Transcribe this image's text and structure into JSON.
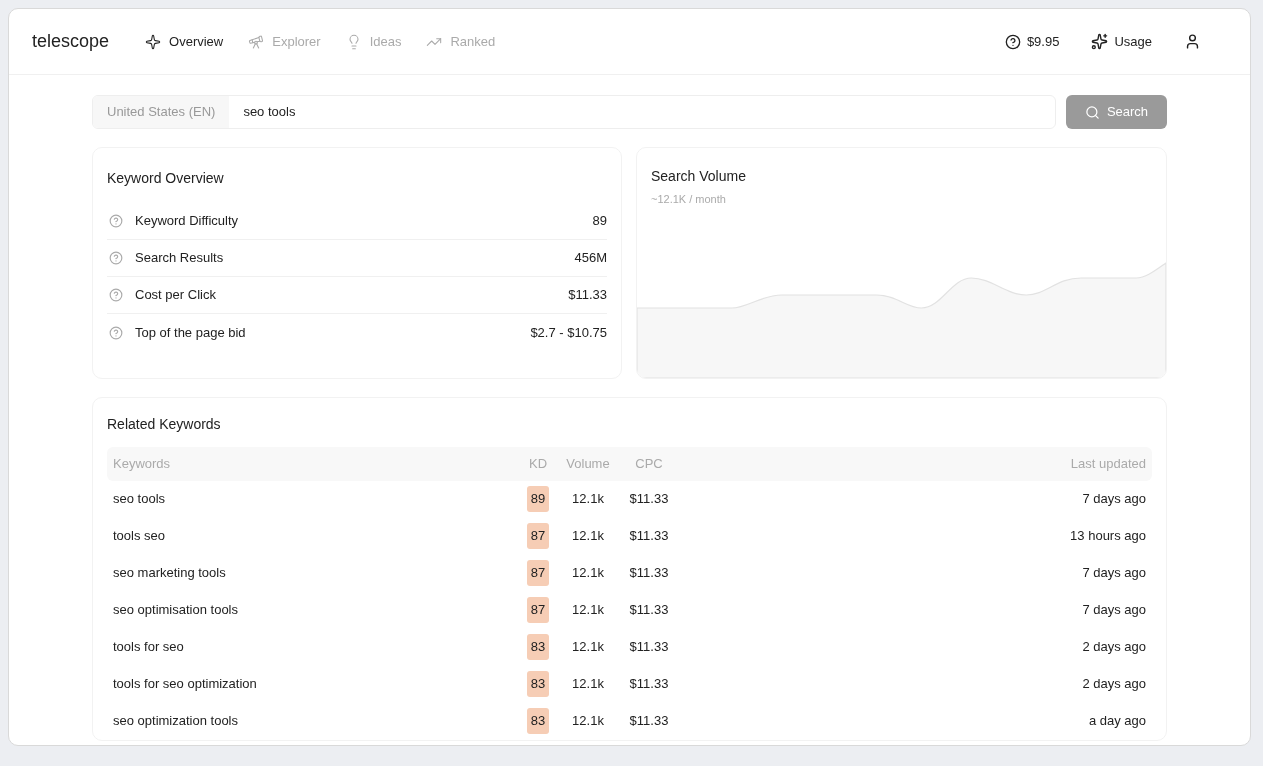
{
  "brand": "telescope",
  "nav": [
    {
      "label": "Overview",
      "selected": true
    },
    {
      "label": "Explorer",
      "selected": false
    },
    {
      "label": "Ideas",
      "selected": false
    },
    {
      "label": "Ranked",
      "selected": false
    }
  ],
  "header_right": {
    "credits": "$9.95",
    "usage": "Usage"
  },
  "search": {
    "region": "United States (EN)",
    "value": "seo tools",
    "button": "Search"
  },
  "overview": {
    "title": "Keyword Overview",
    "metrics": [
      {
        "label": "Keyword Difficulty",
        "value": "89"
      },
      {
        "label": "Search Results",
        "value": "456M"
      },
      {
        "label": "Cost per Click",
        "value": "$11.33"
      },
      {
        "label": "Top of the page bid",
        "value": "$2.7 - $10.75"
      }
    ]
  },
  "volume": {
    "title": "Search Volume",
    "subtitle": "~12.1K / month"
  },
  "related": {
    "title": "Related Keywords",
    "columns": [
      "Keywords",
      "KD",
      "Volume",
      "CPC",
      "Last updated"
    ],
    "rows": [
      {
        "keyword": "seo tools",
        "kd": "89",
        "volume": "12.1k",
        "cpc": "$11.33",
        "updated": "7 days ago"
      },
      {
        "keyword": "tools seo",
        "kd": "87",
        "volume": "12.1k",
        "cpc": "$11.33",
        "updated": "13 hours ago"
      },
      {
        "keyword": "seo marketing tools",
        "kd": "87",
        "volume": "12.1k",
        "cpc": "$11.33",
        "updated": "7 days ago"
      },
      {
        "keyword": "seo optimisation tools",
        "kd": "87",
        "volume": "12.1k",
        "cpc": "$11.33",
        "updated": "7 days ago"
      },
      {
        "keyword": "tools for seo",
        "kd": "83",
        "volume": "12.1k",
        "cpc": "$11.33",
        "updated": "2 days ago"
      },
      {
        "keyword": "tools for seo optimization",
        "kd": "83",
        "volume": "12.1k",
        "cpc": "$11.33",
        "updated": "2 days ago"
      },
      {
        "keyword": "seo optimization tools",
        "kd": "83",
        "volume": "12.1k",
        "cpc": "$11.33",
        "updated": "a day ago"
      }
    ]
  }
}
